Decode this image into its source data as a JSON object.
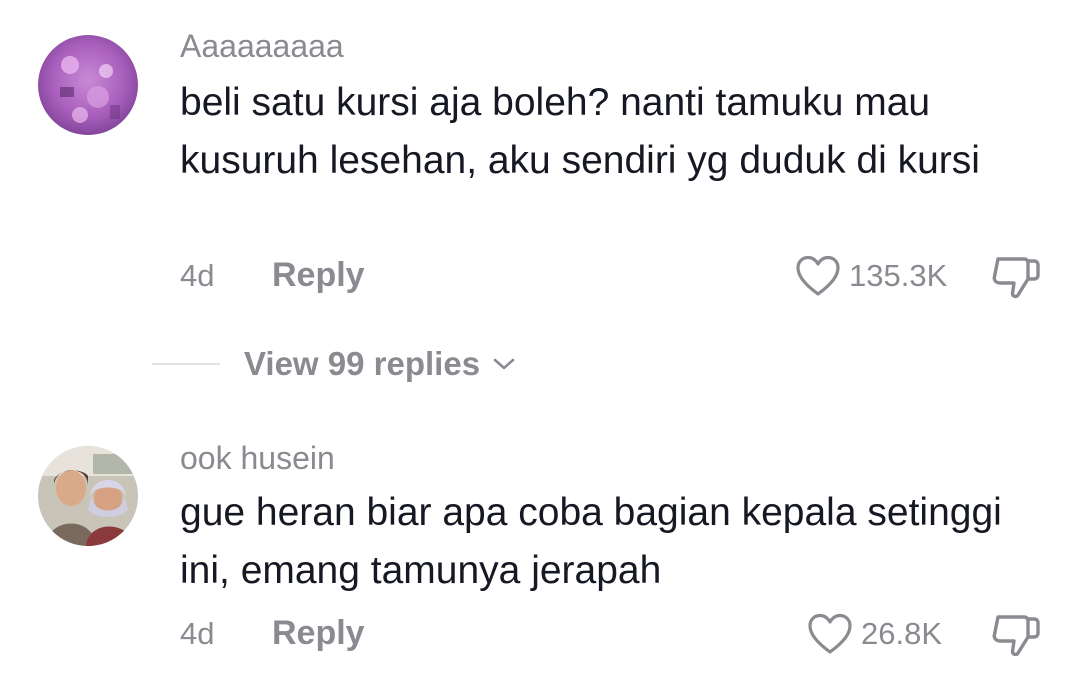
{
  "comments": [
    {
      "username": "Aaaaaaaaa",
      "text": "beli satu kursi aja boleh? nanti tamuku mau kusuruh lesehan, aku sendiri yg duduk di kursi",
      "age": "4d",
      "reply_label": "Reply",
      "likes": "135.3K",
      "avatar_icon": "user-avatar-purple"
    },
    {
      "username": "ook husein",
      "text": "gue heran biar apa coba bagian kepala setinggi ini, emang tamunya jerapah",
      "age": "4d",
      "reply_label": "Reply",
      "likes": "26.8K",
      "avatar_icon": "user-avatar-photo"
    }
  ],
  "view_replies": {
    "label": "View 99 replies"
  },
  "colors": {
    "primary_text": "#161823",
    "secondary_text": "#8a8b91",
    "divider": "#e3e3e4"
  }
}
